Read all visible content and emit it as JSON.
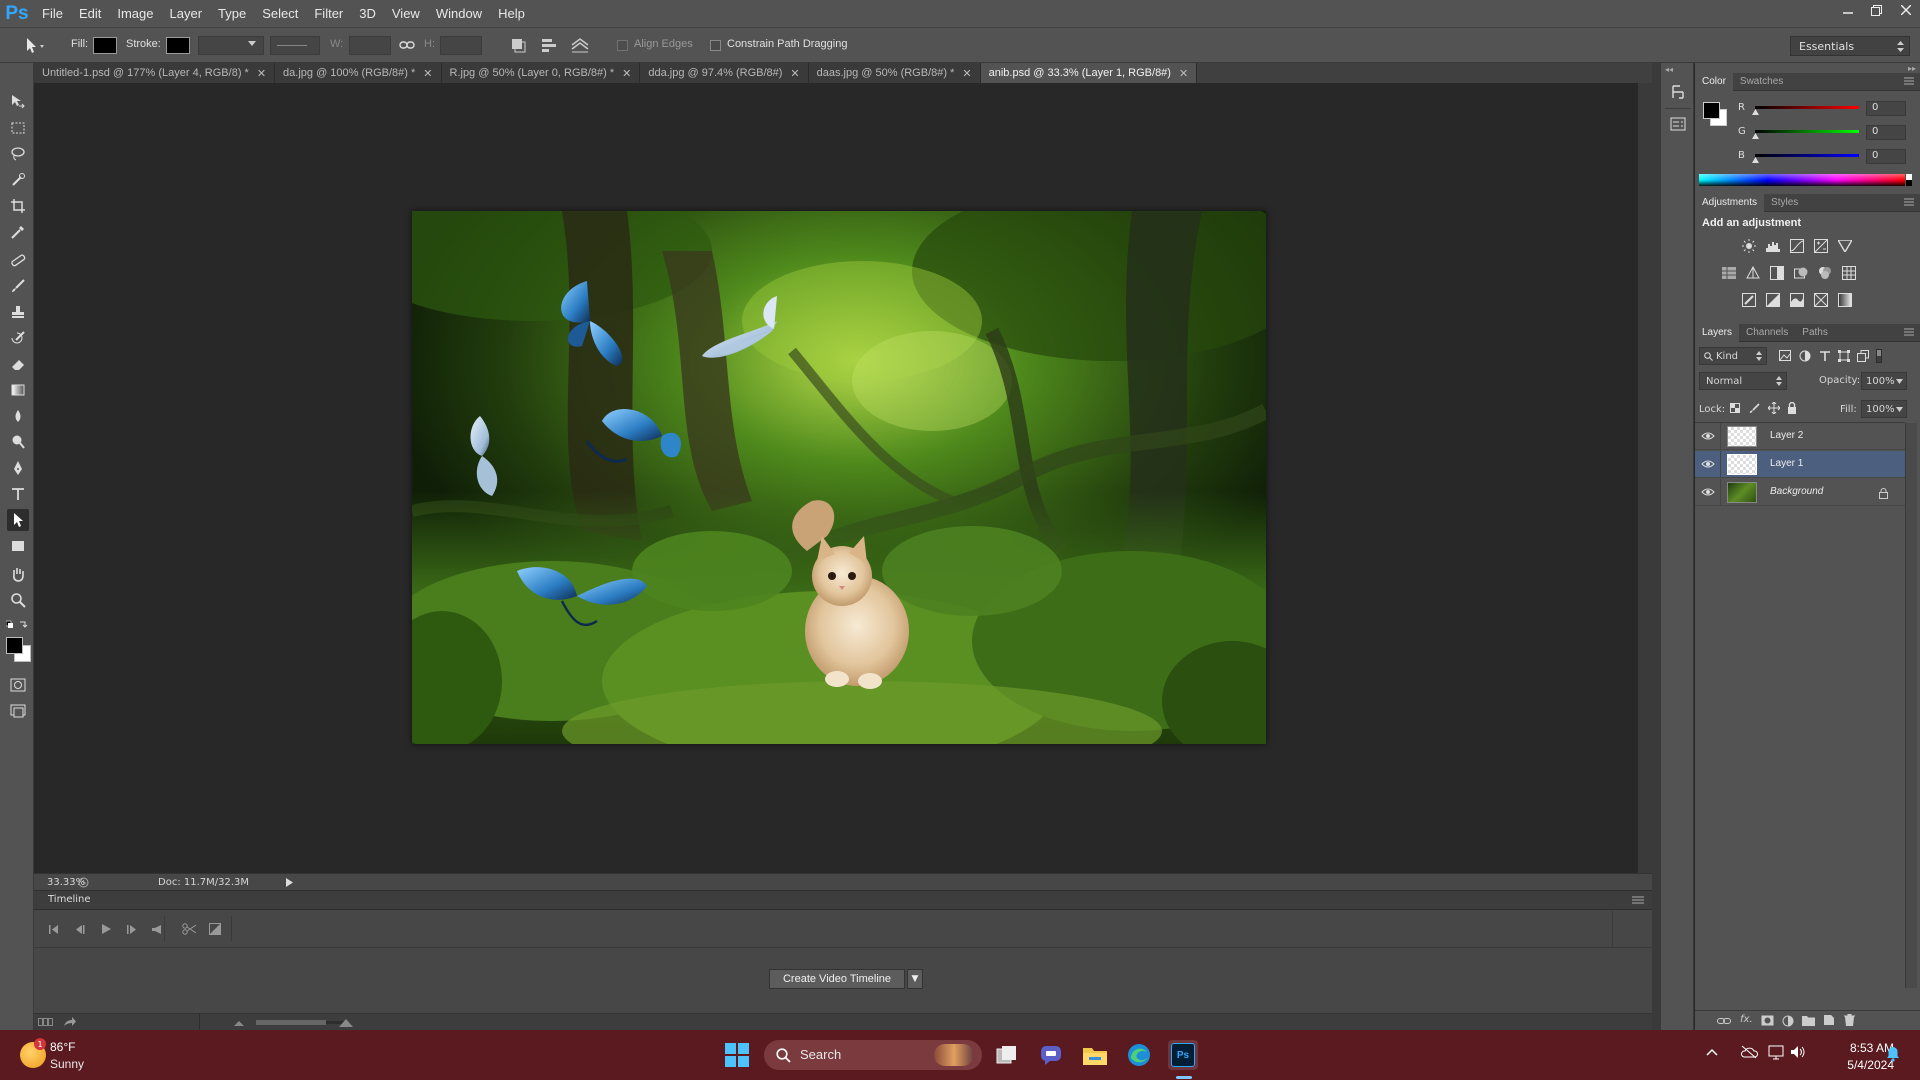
{
  "app": {
    "logo": "Ps",
    "window_controls": [
      "minimize",
      "restore",
      "close"
    ]
  },
  "menu": [
    "File",
    "Edit",
    "Image",
    "Layer",
    "Type",
    "Select",
    "Filter",
    "3D",
    "View",
    "Window",
    "Help"
  ],
  "options_bar": {
    "fill_label": "Fill:",
    "stroke_label": "Stroke:",
    "w_label": "W:",
    "h_label": "H:",
    "align_edges": "Align Edges",
    "constrain_path": "Constrain Path Dragging",
    "workspace": "Essentials",
    "fill_color": "#000000",
    "stroke_color": "#000000"
  },
  "tabs": [
    {
      "label": "Untitled-1.psd @ 177% (Layer 4, RGB/8) *",
      "active": false
    },
    {
      "label": "da.jpg @ 100% (RGB/8#) *",
      "active": false
    },
    {
      "label": "R.jpg @ 50% (Layer 0, RGB/8#) *",
      "active": false
    },
    {
      "label": "dda.jpg @ 97.4% (RGB/8#)",
      "active": false
    },
    {
      "label": "daas.jpg @ 50% (RGB/8#) *",
      "active": false
    },
    {
      "label": "anib.psd @ 33.3% (Layer 1, RGB/8#)",
      "active": true
    }
  ],
  "tools": [
    "move-tool",
    "marquee-tool",
    "lasso-tool",
    "quick-selection-tool",
    "crop-tool",
    "eyedropper-tool",
    "spot-healing-tool",
    "brush-tool",
    "clone-stamp-tool",
    "history-brush-tool",
    "eraser-tool",
    "gradient-tool",
    "blur-tool",
    "dodge-tool",
    "pen-tool",
    "type-tool",
    "path-selection-tool",
    "rectangle-tool",
    "hand-tool",
    "zoom-tool"
  ],
  "status": {
    "zoom": "33.33%",
    "doc": "Doc: 11.7M/32.3M"
  },
  "timeline": {
    "title": "Timeline",
    "create_button": "Create Video Timeline"
  },
  "color_panel": {
    "tabs": [
      "Color",
      "Swatches"
    ],
    "channels": [
      {
        "label": "R",
        "value": "0",
        "color": "#e02020"
      },
      {
        "label": "G",
        "value": "0",
        "color": "#20c020"
      },
      {
        "label": "B",
        "value": "0",
        "color": "#2040e0"
      }
    ]
  },
  "adjustments_panel": {
    "tabs": [
      "Adjustments",
      "Styles"
    ],
    "title": "Add an adjustment"
  },
  "layers_panel": {
    "tabs": [
      "Layers",
      "Channels",
      "Paths"
    ],
    "kind": "Kind",
    "blend_mode": "Normal",
    "opacity_label": "Opacity:",
    "opacity": "100%",
    "lock_label": "Lock:",
    "fill_label": "Fill:",
    "fill": "100%",
    "layers": [
      {
        "name": "Layer 2",
        "selected": false,
        "italic": false
      },
      {
        "name": "Layer 1",
        "selected": true,
        "italic": false
      },
      {
        "name": "Background",
        "selected": false,
        "italic": true
      }
    ]
  },
  "taskbar": {
    "weather_temp": "86°F",
    "weather_desc": "Sunny",
    "weather_badge": "1",
    "search": "Search",
    "time": "8:53 AM",
    "date": "5/4/2024"
  }
}
